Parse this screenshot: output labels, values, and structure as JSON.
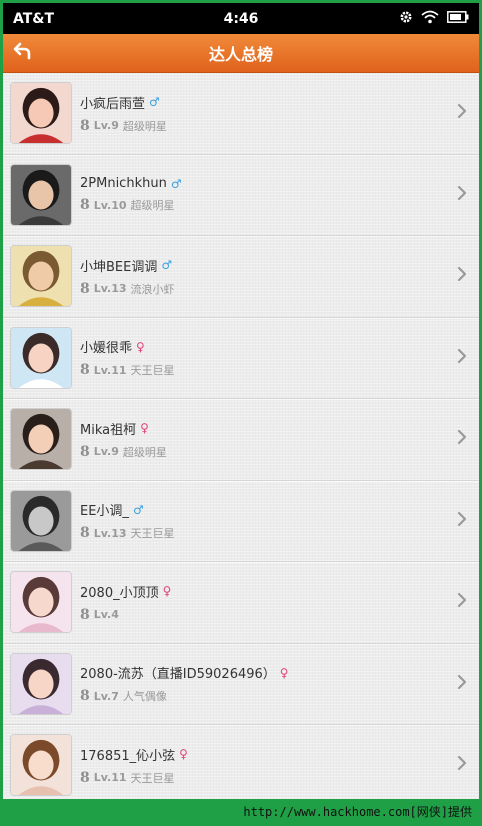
{
  "status_bar": {
    "carrier": "AT&T",
    "time": "4:46",
    "icons": [
      "settings-icon",
      "wifi-icon",
      "battery-icon"
    ]
  },
  "header": {
    "title": "达人总榜",
    "back_icon": "back-arrow-icon"
  },
  "users": [
    {
      "name": "小疯后雨萱",
      "gender": "male",
      "level": "Lv.9",
      "title": "超级明星"
    },
    {
      "name": "2PMnichkhun",
      "gender": "male",
      "level": "Lv.10",
      "title": "超级明星"
    },
    {
      "name": "小坤BEE调调",
      "gender": "male",
      "level": "Lv.13",
      "title": "流浪小虾"
    },
    {
      "name": "小媛很乖",
      "gender": "female",
      "level": "Lv.11",
      "title": "天王巨星"
    },
    {
      "name": "Mika祖柯",
      "gender": "female",
      "level": "Lv.9",
      "title": "超级明星"
    },
    {
      "name": "EE小调_",
      "gender": "male",
      "level": "Lv.13",
      "title": "天王巨星"
    },
    {
      "name": "2080_小顶顶",
      "gender": "female",
      "level": "Lv.4",
      "title": ""
    },
    {
      "name": "2080-流苏（直播ID59026496）",
      "gender": "female",
      "level": "Lv.7",
      "title": "人气偶像"
    },
    {
      "name": "176851_伈小弦",
      "gender": "female",
      "level": "Lv.11",
      "title": "天王巨星"
    }
  ],
  "gender_symbols": {
    "male": "♂",
    "female": "♀"
  },
  "level_icon": "8",
  "watermark": "http://www.hackhome.com[网侠]提供",
  "colors": {
    "header_orange": "#e8742a",
    "male_blue": "#3aa0dd",
    "female_pink": "#e0447d",
    "border_green": "#1fa046"
  }
}
